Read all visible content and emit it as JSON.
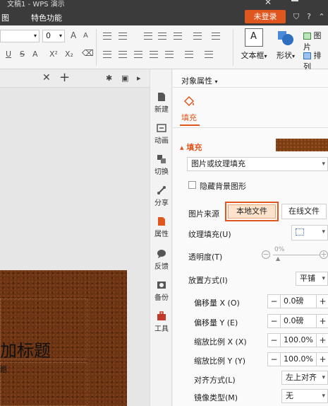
{
  "window": {
    "doc_title": "文稿1 - WPS 演示"
  },
  "menu": {
    "items": [
      "图",
      "特色功能"
    ],
    "login_label": "未登录"
  },
  "ribbon": {
    "font_size": "0",
    "grow_font": "A",
    "shrink_font": "A",
    "format_buttons": [
      "U",
      "S",
      "A",
      "X²",
      "X₂"
    ],
    "textbox_label": "文本框",
    "shape_label": "形状",
    "picture_label": "图片",
    "arrange_label": "排列"
  },
  "slide": {
    "title_text": "加标题",
    "subtitle_text": "题"
  },
  "sidebar": {
    "items": [
      {
        "label": "新建",
        "icon": "new-icon"
      },
      {
        "label": "动画",
        "icon": "animation-icon"
      },
      {
        "label": "切换",
        "icon": "transition-icon"
      },
      {
        "label": "分享",
        "icon": "share-icon"
      },
      {
        "label": "属性",
        "icon": "properties-icon"
      },
      {
        "label": "反馈",
        "icon": "feedback-icon"
      },
      {
        "label": "备份",
        "icon": "backup-icon"
      },
      {
        "label": "工具",
        "icon": "toolbox-icon"
      }
    ]
  },
  "panel": {
    "title": "对象属性",
    "fill_tab": "填充",
    "fill_section": "填充",
    "fill_type": "图片或纹理填充",
    "hide_bg_label": "隐藏背景图形",
    "picture_source_label": "图片来源",
    "local_file_label": "本地文件",
    "online_file_label": "在线文件",
    "texture_fill_label": "纹理填充(U)",
    "transparency_label": "透明度(T)",
    "transparency_value": "0%",
    "placement_label": "放置方式(I)",
    "placement_value": "平铺",
    "offset_x_label": "偏移量 X (O)",
    "offset_x_value": "0.0磅",
    "offset_y_label": "偏移量 Y (E)",
    "offset_y_value": "0.0磅",
    "scale_x_label": "缩放比例 X (X)",
    "scale_x_value": "100.0%",
    "scale_y_label": "缩放比例 Y (Y)",
    "scale_y_value": "100.0%",
    "align_label": "对齐方式(L)",
    "align_value": "左上对齐",
    "mirror_label": "镜像类型(M)",
    "mirror_value": "无"
  },
  "colors": {
    "accent": "#e0561f",
    "titlebar": "#3b3b3b",
    "wood": "#6b3414"
  }
}
